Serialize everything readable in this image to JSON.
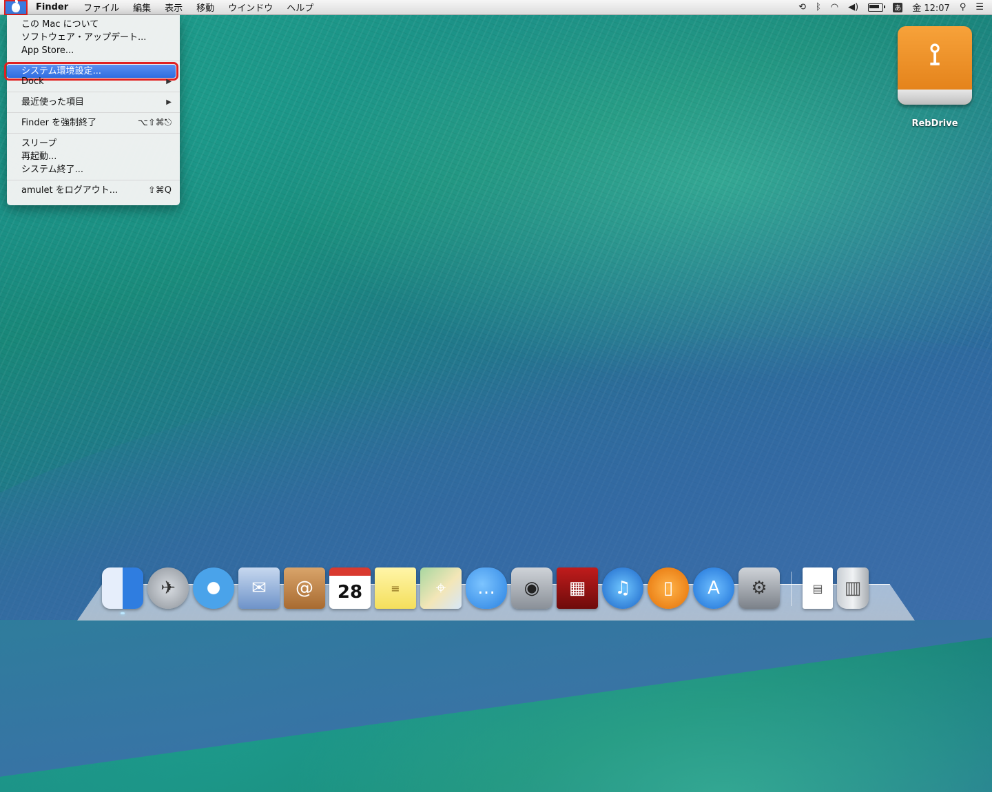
{
  "menubar": {
    "app_name": "Finder",
    "menus": [
      "ファイル",
      "編集",
      "表示",
      "移動",
      "ウインドウ",
      "ヘルプ"
    ],
    "clock": "金 12:07",
    "ime": "あ",
    "status_icons": [
      "time-machine-icon",
      "bluetooth-icon",
      "wifi-icon",
      "volume-icon",
      "battery-icon",
      "input-method-icon",
      "spotlight-icon",
      "notification-center-icon"
    ]
  },
  "apple_menu": {
    "about": "この Mac について",
    "software_update": "ソフトウェア・アップデート...",
    "app_store": "App Store...",
    "system_prefs": "システム環境設定...",
    "dock": "Dock",
    "recent_items": "最近使った項目",
    "force_quit": "Finder を強制終了",
    "force_quit_shortcut": "⌥⇧⌘⎋",
    "sleep": "スリープ",
    "restart": "再起動...",
    "shutdown": "システム終了...",
    "logout": "amulet をログアウト...",
    "logout_shortcut": "⇧⌘Q",
    "submenu_arrow": "▶"
  },
  "desktop": {
    "drive_label": "RebDrive"
  },
  "dock": {
    "calendar_day": "28"
  },
  "colors": {
    "highlight": "#2f6de0",
    "annotation_red": "#e02020",
    "drive_orange": "#f39a2e"
  }
}
